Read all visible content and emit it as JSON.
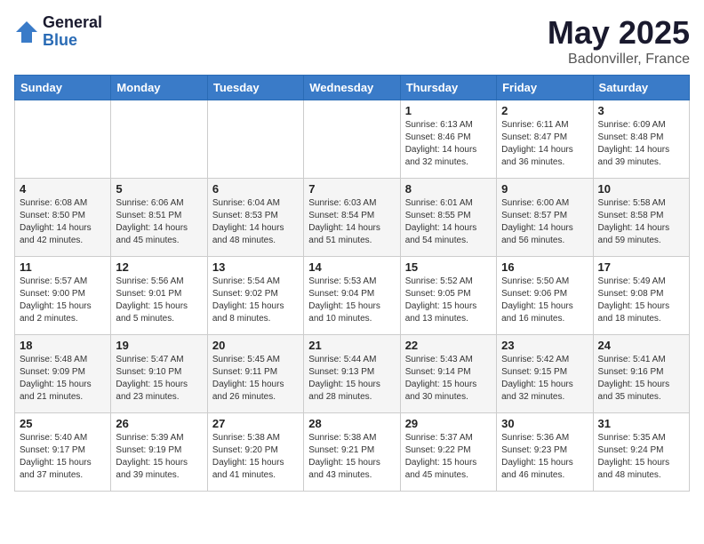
{
  "logo": {
    "general": "General",
    "blue": "Blue"
  },
  "title": {
    "month_year": "May 2025",
    "location": "Badonviller, France"
  },
  "weekdays": [
    "Sunday",
    "Monday",
    "Tuesday",
    "Wednesday",
    "Thursday",
    "Friday",
    "Saturday"
  ],
  "weeks": [
    [
      {
        "day": "",
        "info": ""
      },
      {
        "day": "",
        "info": ""
      },
      {
        "day": "",
        "info": ""
      },
      {
        "day": "",
        "info": ""
      },
      {
        "day": "1",
        "info": "Sunrise: 6:13 AM\nSunset: 8:46 PM\nDaylight: 14 hours and 32 minutes."
      },
      {
        "day": "2",
        "info": "Sunrise: 6:11 AM\nSunset: 8:47 PM\nDaylight: 14 hours and 36 minutes."
      },
      {
        "day": "3",
        "info": "Sunrise: 6:09 AM\nSunset: 8:48 PM\nDaylight: 14 hours and 39 minutes."
      }
    ],
    [
      {
        "day": "4",
        "info": "Sunrise: 6:08 AM\nSunset: 8:50 PM\nDaylight: 14 hours and 42 minutes."
      },
      {
        "day": "5",
        "info": "Sunrise: 6:06 AM\nSunset: 8:51 PM\nDaylight: 14 hours and 45 minutes."
      },
      {
        "day": "6",
        "info": "Sunrise: 6:04 AM\nSunset: 8:53 PM\nDaylight: 14 hours and 48 minutes."
      },
      {
        "day": "7",
        "info": "Sunrise: 6:03 AM\nSunset: 8:54 PM\nDaylight: 14 hours and 51 minutes."
      },
      {
        "day": "8",
        "info": "Sunrise: 6:01 AM\nSunset: 8:55 PM\nDaylight: 14 hours and 54 minutes."
      },
      {
        "day": "9",
        "info": "Sunrise: 6:00 AM\nSunset: 8:57 PM\nDaylight: 14 hours and 56 minutes."
      },
      {
        "day": "10",
        "info": "Sunrise: 5:58 AM\nSunset: 8:58 PM\nDaylight: 14 hours and 59 minutes."
      }
    ],
    [
      {
        "day": "11",
        "info": "Sunrise: 5:57 AM\nSunset: 9:00 PM\nDaylight: 15 hours and 2 minutes."
      },
      {
        "day": "12",
        "info": "Sunrise: 5:56 AM\nSunset: 9:01 PM\nDaylight: 15 hours and 5 minutes."
      },
      {
        "day": "13",
        "info": "Sunrise: 5:54 AM\nSunset: 9:02 PM\nDaylight: 15 hours and 8 minutes."
      },
      {
        "day": "14",
        "info": "Sunrise: 5:53 AM\nSunset: 9:04 PM\nDaylight: 15 hours and 10 minutes."
      },
      {
        "day": "15",
        "info": "Sunrise: 5:52 AM\nSunset: 9:05 PM\nDaylight: 15 hours and 13 minutes."
      },
      {
        "day": "16",
        "info": "Sunrise: 5:50 AM\nSunset: 9:06 PM\nDaylight: 15 hours and 16 minutes."
      },
      {
        "day": "17",
        "info": "Sunrise: 5:49 AM\nSunset: 9:08 PM\nDaylight: 15 hours and 18 minutes."
      }
    ],
    [
      {
        "day": "18",
        "info": "Sunrise: 5:48 AM\nSunset: 9:09 PM\nDaylight: 15 hours and 21 minutes."
      },
      {
        "day": "19",
        "info": "Sunrise: 5:47 AM\nSunset: 9:10 PM\nDaylight: 15 hours and 23 minutes."
      },
      {
        "day": "20",
        "info": "Sunrise: 5:45 AM\nSunset: 9:11 PM\nDaylight: 15 hours and 26 minutes."
      },
      {
        "day": "21",
        "info": "Sunrise: 5:44 AM\nSunset: 9:13 PM\nDaylight: 15 hours and 28 minutes."
      },
      {
        "day": "22",
        "info": "Sunrise: 5:43 AM\nSunset: 9:14 PM\nDaylight: 15 hours and 30 minutes."
      },
      {
        "day": "23",
        "info": "Sunrise: 5:42 AM\nSunset: 9:15 PM\nDaylight: 15 hours and 32 minutes."
      },
      {
        "day": "24",
        "info": "Sunrise: 5:41 AM\nSunset: 9:16 PM\nDaylight: 15 hours and 35 minutes."
      }
    ],
    [
      {
        "day": "25",
        "info": "Sunrise: 5:40 AM\nSunset: 9:17 PM\nDaylight: 15 hours and 37 minutes."
      },
      {
        "day": "26",
        "info": "Sunrise: 5:39 AM\nSunset: 9:19 PM\nDaylight: 15 hours and 39 minutes."
      },
      {
        "day": "27",
        "info": "Sunrise: 5:38 AM\nSunset: 9:20 PM\nDaylight: 15 hours and 41 minutes."
      },
      {
        "day": "28",
        "info": "Sunrise: 5:38 AM\nSunset: 9:21 PM\nDaylight: 15 hours and 43 minutes."
      },
      {
        "day": "29",
        "info": "Sunrise: 5:37 AM\nSunset: 9:22 PM\nDaylight: 15 hours and 45 minutes."
      },
      {
        "day": "30",
        "info": "Sunrise: 5:36 AM\nSunset: 9:23 PM\nDaylight: 15 hours and 46 minutes."
      },
      {
        "day": "31",
        "info": "Sunrise: 5:35 AM\nSunset: 9:24 PM\nDaylight: 15 hours and 48 minutes."
      }
    ]
  ]
}
